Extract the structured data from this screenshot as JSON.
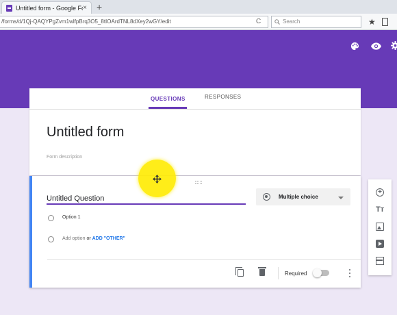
{
  "browser": {
    "tab_title": "Untitled form - Google For...",
    "tab_close": "×",
    "new_tab": "+",
    "url": "/forms/d/1Qj-QAQYPgZvm1wlfpBrq3O5_8tIOArdTNL8dXey2wGY/edit",
    "reload": "C",
    "search_placeholder": "Search",
    "star": "★"
  },
  "header": {
    "palette_icon": "palette-icon",
    "preview_icon": "eye-icon",
    "settings_icon": "gear-icon"
  },
  "tabs": {
    "questions": "QUESTIONS",
    "responses": "RESPONSES"
  },
  "form": {
    "title": "Untitled form",
    "description_placeholder": "Form description"
  },
  "question": {
    "title": "Untitled Question",
    "type": "Multiple choice",
    "option1": "Option 1",
    "add_option": "Add option",
    "or": "or",
    "add_other": "ADD \"OTHER\"",
    "required_label": "Required",
    "required": false
  },
  "side_toolbar": {
    "title_icon": "Tт"
  },
  "colors": {
    "accent": "#673ab7",
    "background": "#ede7f6",
    "active_border": "#4285f4",
    "link": "#1a73e8"
  }
}
